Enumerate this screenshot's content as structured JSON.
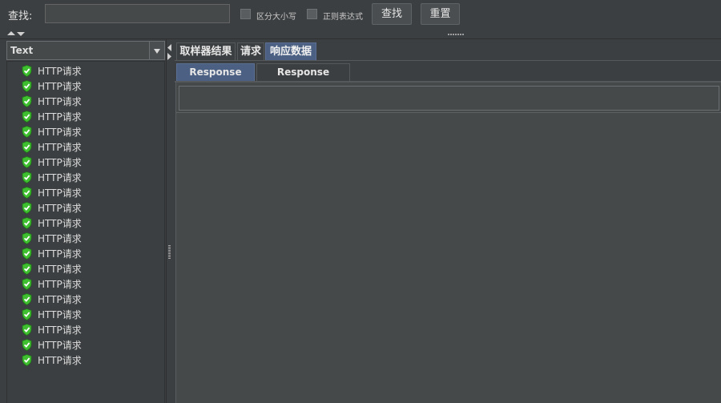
{
  "search": {
    "label": "查找:",
    "value": "",
    "case_sensitive_label": "区分大小写",
    "regex_label": "正则表达式",
    "find_button": "查找",
    "reset_button": "重置"
  },
  "left_panel": {
    "renderer_selected": "Text",
    "items": [
      "HTTP请求",
      "HTTP请求",
      "HTTP请求",
      "HTTP请求",
      "HTTP请求",
      "HTTP请求",
      "HTTP请求",
      "HTTP请求",
      "HTTP请求",
      "HTTP请求",
      "HTTP请求",
      "HTTP请求",
      "HTTP请求",
      "HTTP请求",
      "HTTP请求",
      "HTTP请求",
      "HTTP请求",
      "HTTP请求",
      "HTTP请求",
      "HTTP请求"
    ],
    "item_icon": "green-shield-check-icon"
  },
  "tabs": [
    {
      "label": "取样器结果",
      "active": false
    },
    {
      "label": "请求",
      "active": false
    },
    {
      "label": "响应数据",
      "active": true
    }
  ],
  "subtabs": [
    {
      "label": "Response Body",
      "active": true
    },
    {
      "label": "Response headers",
      "active": false
    }
  ],
  "colors": {
    "background": "#3c3f41",
    "active_tab": "#4b6083",
    "success_icon": "#3fbf2f"
  }
}
